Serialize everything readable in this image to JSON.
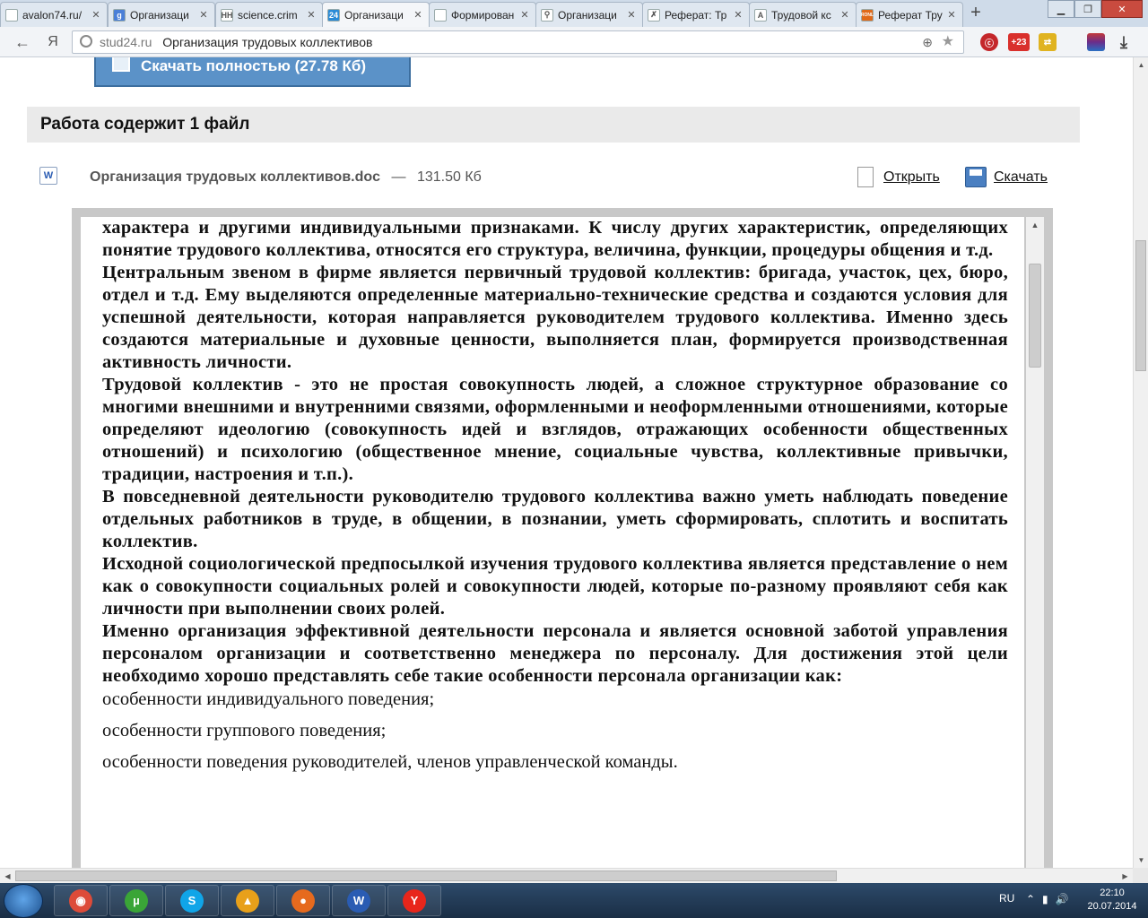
{
  "tabs": [
    {
      "title": "avalon74.ru/",
      "icon": "page-icon",
      "color": "#ffffff",
      "glyph": ""
    },
    {
      "title": "Организаци",
      "icon": "google-icon",
      "color": "#4a7fd8",
      "glyph": "g"
    },
    {
      "title": "science.crim",
      "icon": "science-icon",
      "color": "#ffffff",
      "glyph": "НН"
    },
    {
      "title": "Организаци",
      "icon": "stud24-icon",
      "color": "#2a8bd6",
      "glyph": "24",
      "active": true
    },
    {
      "title": "Формирован",
      "icon": "page-icon",
      "color": "#ffffff",
      "glyph": ""
    },
    {
      "title": "Организаци",
      "icon": "search-icon",
      "color": "#ffffff",
      "glyph": "⚲"
    },
    {
      "title": "Реферат: Тр",
      "icon": "x-icon",
      "color": "#ffffff",
      "glyph": "✗"
    },
    {
      "title": "Трудовой кс",
      "icon": "a-icon",
      "color": "#ffffff",
      "glyph": "A"
    },
    {
      "title": "Реферат Тру",
      "icon": "roxl-icon",
      "color": "#e06a1a",
      "glyph": "RONL"
    }
  ],
  "address": {
    "domain": "stud24.ru",
    "title": "Организация трудовых коллективов"
  },
  "download_button": "Скачать полностью (27.78 Кб)",
  "files_header": "Работа содержит 1 файл",
  "file": {
    "name": "Организация трудовых коллективов.doc",
    "separator": "—",
    "size": "131.50 Кб"
  },
  "actions": {
    "open": "Открыть",
    "download": "Скачать"
  },
  "toolbar_icons": {
    "badge": "+23"
  },
  "document": {
    "paragraphs": [
      "характера и другими индивидуальными признаками. К числу других характеристик, определяющих понятие трудового коллектива, относятся его структура, величина, функции, процедуры общения и т.д.",
      "Центральным звеном в фирме является первичный трудовой коллектив: бригада, участок, цех, бюро, отдел и т.д. Ему выделяются определенные материально-технические средства и создаются условия для успешной деятельности, которая направляется руководителем трудового коллектива. Именно здесь создаются материальные и духовные ценности, выполняется план, формируется производственная активность личности.",
      "Трудовой коллектив - это не простая совокупность людей, а сложное структурное образование со многими внешними и внутренними связями, оформленными и неоформленными отношениями, которые определяют идеологию (совокупность идей и взглядов, отражающих особенности общественных отношений) и психологию (общественное мнение, социальные чувства, коллективные привычки, традиции, настроения и т.п.).",
      "В повседневной деятельности руководителю трудового коллектива важно уметь наблюдать поведение отдельных работников в труде, в общении, в познании, уметь сформировать, сплотить и воспитать коллектив.",
      "Исходной социологической предпосылкой изучения трудового коллектива является представление о нем как о совокупности социальных ролей и совокупности людей, которые по-разному проявляют себя как личности при выполнении своих ролей.",
      "Именно организация эффективной деятельности персонала и является основной заботой управления персоналом организации и соответственно менеджера по персоналу. Для достижения этой цели необходимо хорошо представлять себе такие особенности персонала организации как:"
    ],
    "list_items": [
      "особенности индивидуального поведения;",
      "особенности группового поведения;",
      "особенности поведения руководителей, членов управленческой команды."
    ]
  },
  "taskbar": {
    "apps": [
      {
        "name": "chrome",
        "color": "#dd4b39",
        "glyph": "◉"
      },
      {
        "name": "utorrent",
        "color": "#3aa537",
        "glyph": "µ"
      },
      {
        "name": "skype",
        "color": "#10a5e8",
        "glyph": "S"
      },
      {
        "name": "aimp",
        "color": "#e8a01a",
        "glyph": "▲"
      },
      {
        "name": "origin",
        "color": "#e66a1e",
        "glyph": "●"
      },
      {
        "name": "word",
        "color": "#2a5cb3",
        "glyph": "W"
      },
      {
        "name": "yandex",
        "color": "#e8261b",
        "glyph": "Y"
      }
    ],
    "lang": "RU",
    "time": "22:10",
    "date": "20.07.2014"
  }
}
